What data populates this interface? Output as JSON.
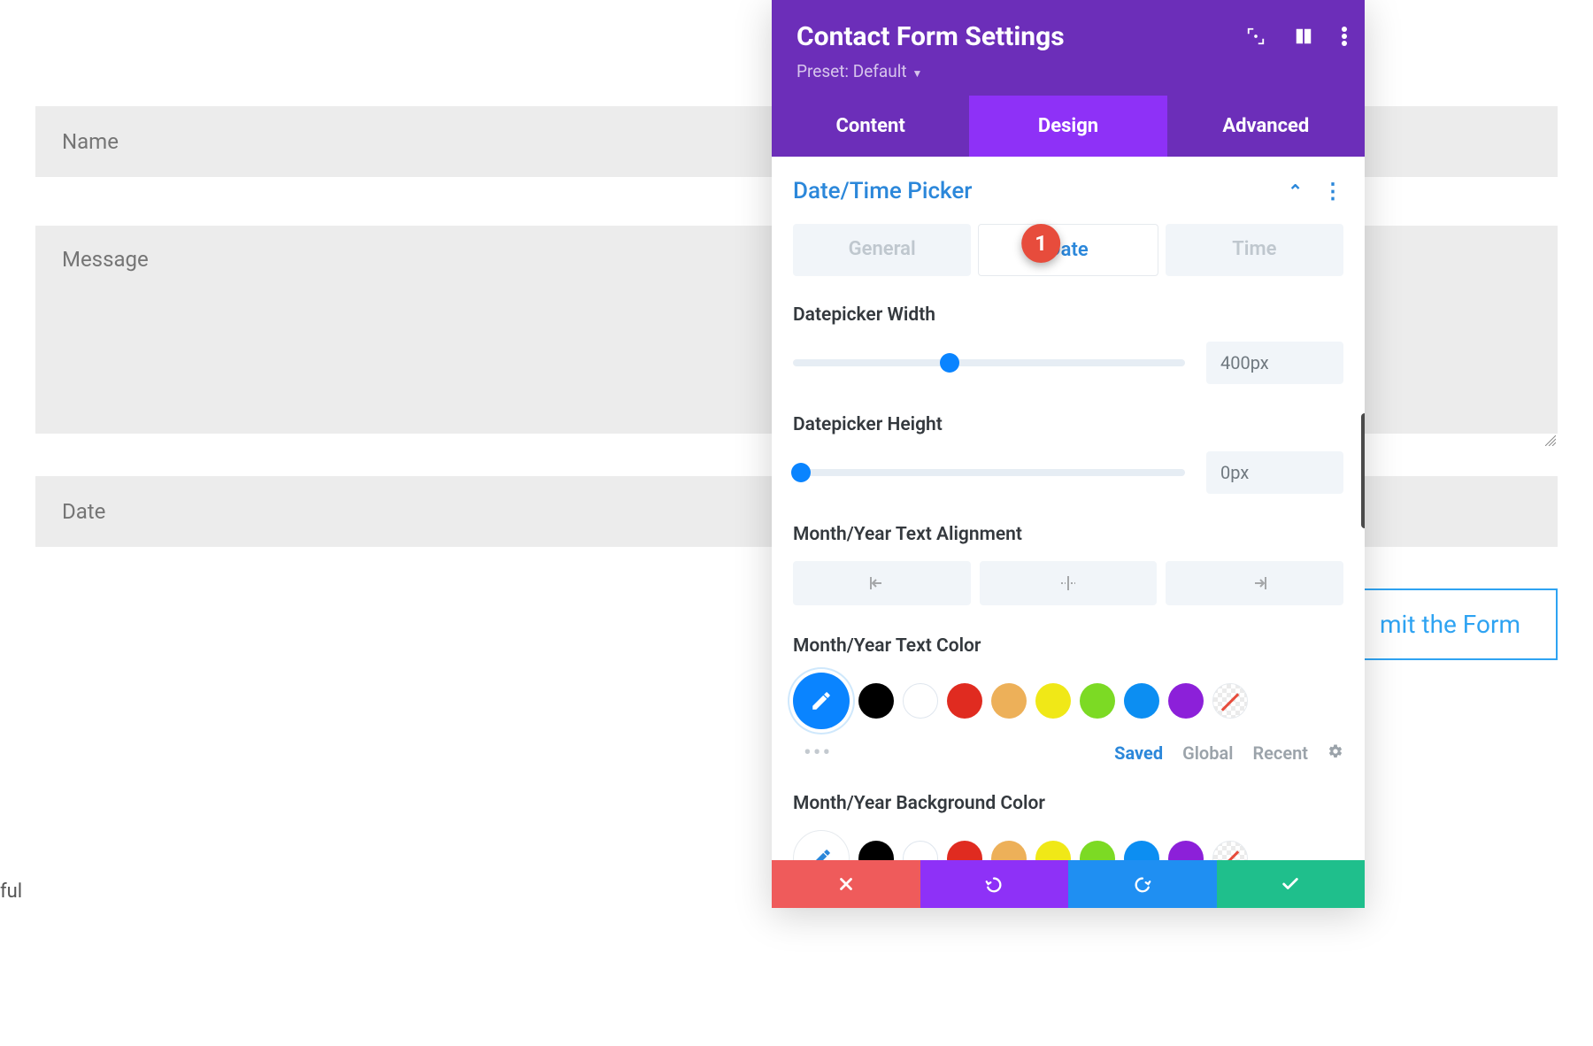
{
  "form": {
    "name_placeholder": "Name",
    "message_placeholder": "Message",
    "date_placeholder": "Date",
    "submit_label": "mit the Form"
  },
  "stray_text": "ful",
  "panel": {
    "title": "Contact Form Settings",
    "preset_label": "Preset: Default",
    "tabs": {
      "content": "Content",
      "design": "Design",
      "advanced": "Advanced"
    },
    "section": {
      "title": "Date/Time Picker",
      "subtabs": {
        "general": "General",
        "date": "Date",
        "time": "Time"
      }
    },
    "controls": {
      "width_label": "Datepicker Width",
      "width_value": "400px",
      "height_label": "Datepicker Height",
      "height_value": "0px",
      "align_label": "Month/Year Text Alignment",
      "text_color_label": "Month/Year Text Color",
      "bg_color_label": "Month/Year Background Color"
    },
    "swatches": [
      "#000000",
      "#ffffff",
      "#e02b20",
      "#edb059",
      "#f0e817",
      "#7cda24",
      "#0c8ef2",
      "#8c20d9"
    ],
    "color_filter": {
      "saved": "Saved",
      "global": "Global",
      "recent": "Recent"
    },
    "annotation_badge": "1"
  }
}
